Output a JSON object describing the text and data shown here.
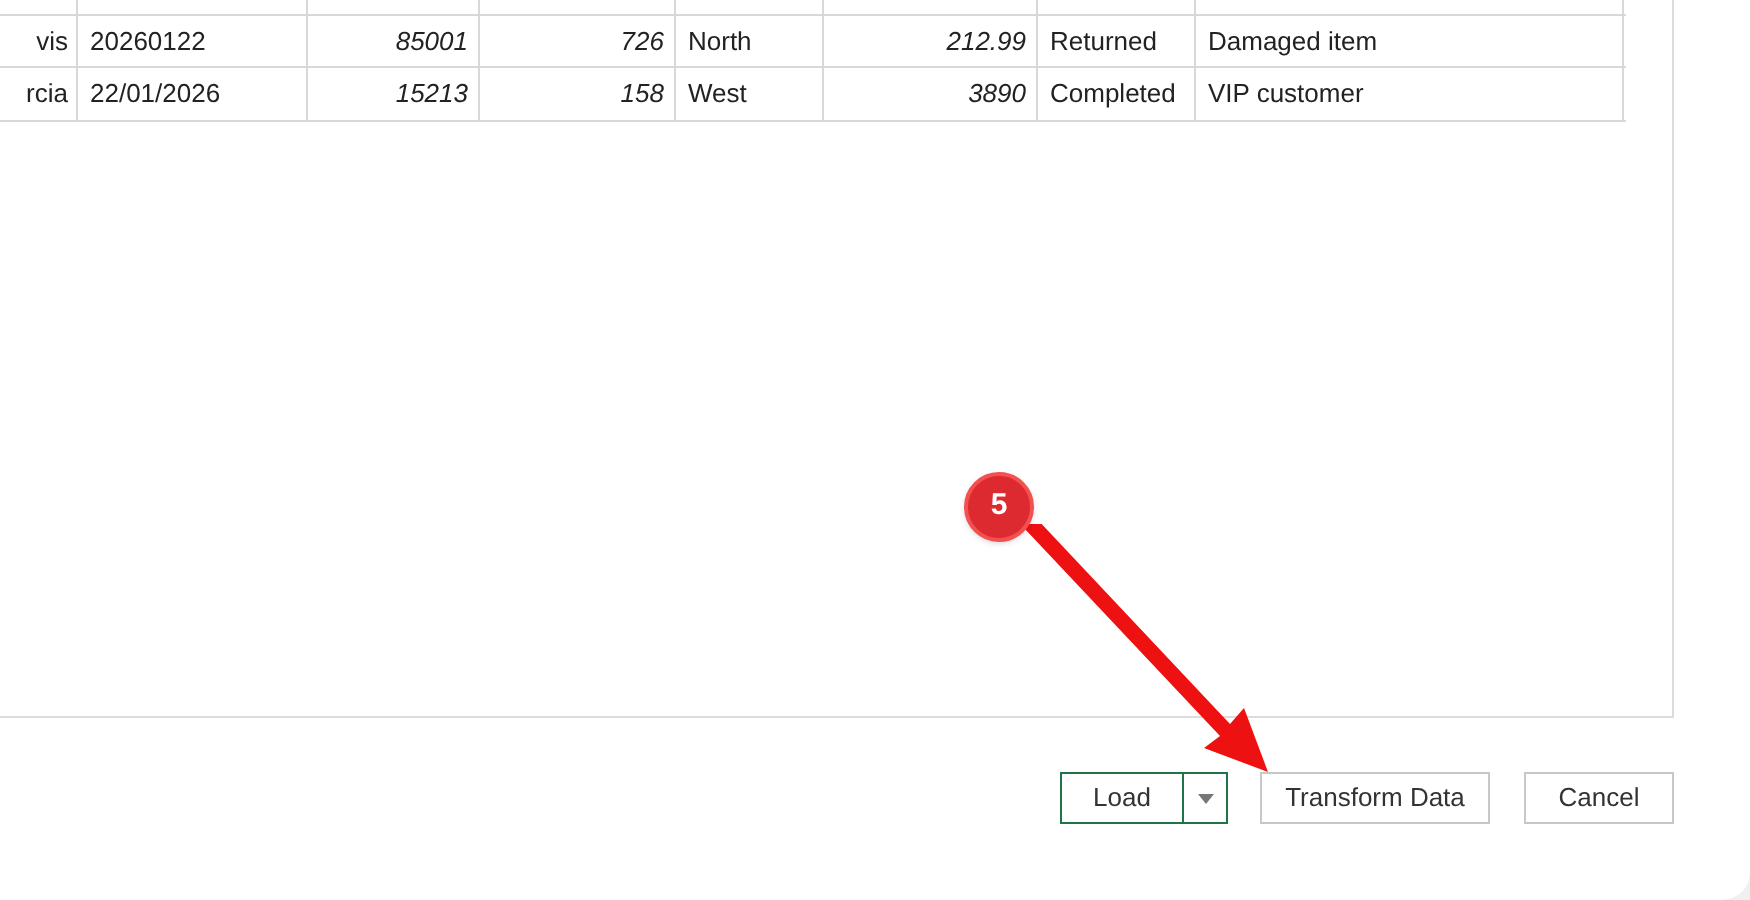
{
  "table": {
    "rows": [
      {
        "cells": [
          "vis",
          "20260122",
          "85001",
          "726",
          "North",
          "212.99",
          "Returned",
          "Damaged item"
        ]
      },
      {
        "cells": [
          "rcia",
          "22/01/2026",
          "15213",
          "158",
          "West",
          "3890",
          "Completed",
          "VIP customer"
        ]
      }
    ]
  },
  "buttons": {
    "load": "Load",
    "transform": "Transform Data",
    "cancel": "Cancel"
  },
  "annotation": {
    "label": "5"
  }
}
